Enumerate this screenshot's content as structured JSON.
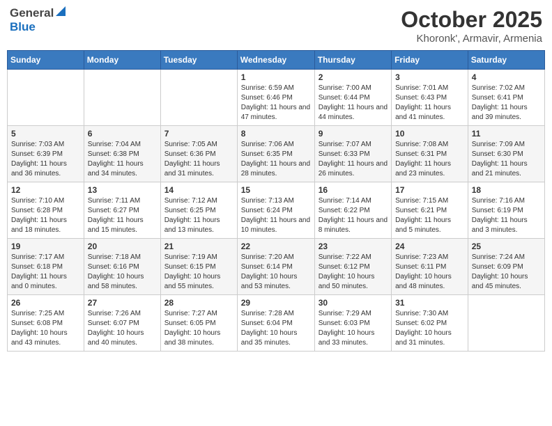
{
  "header": {
    "logo_general": "General",
    "logo_blue": "Blue",
    "month_title": "October 2025",
    "location": "Khoronk', Armavir, Armenia"
  },
  "weekdays": [
    "Sunday",
    "Monday",
    "Tuesday",
    "Wednesday",
    "Thursday",
    "Friday",
    "Saturday"
  ],
  "weeks": [
    [
      {
        "num": "",
        "info": ""
      },
      {
        "num": "",
        "info": ""
      },
      {
        "num": "",
        "info": ""
      },
      {
        "num": "1",
        "info": "Sunrise: 6:59 AM\nSunset: 6:46 PM\nDaylight: 11 hours and 47 minutes."
      },
      {
        "num": "2",
        "info": "Sunrise: 7:00 AM\nSunset: 6:44 PM\nDaylight: 11 hours and 44 minutes."
      },
      {
        "num": "3",
        "info": "Sunrise: 7:01 AM\nSunset: 6:43 PM\nDaylight: 11 hours and 41 minutes."
      },
      {
        "num": "4",
        "info": "Sunrise: 7:02 AM\nSunset: 6:41 PM\nDaylight: 11 hours and 39 minutes."
      }
    ],
    [
      {
        "num": "5",
        "info": "Sunrise: 7:03 AM\nSunset: 6:39 PM\nDaylight: 11 hours and 36 minutes."
      },
      {
        "num": "6",
        "info": "Sunrise: 7:04 AM\nSunset: 6:38 PM\nDaylight: 11 hours and 34 minutes."
      },
      {
        "num": "7",
        "info": "Sunrise: 7:05 AM\nSunset: 6:36 PM\nDaylight: 11 hours and 31 minutes."
      },
      {
        "num": "8",
        "info": "Sunrise: 7:06 AM\nSunset: 6:35 PM\nDaylight: 11 hours and 28 minutes."
      },
      {
        "num": "9",
        "info": "Sunrise: 7:07 AM\nSunset: 6:33 PM\nDaylight: 11 hours and 26 minutes."
      },
      {
        "num": "10",
        "info": "Sunrise: 7:08 AM\nSunset: 6:31 PM\nDaylight: 11 hours and 23 minutes."
      },
      {
        "num": "11",
        "info": "Sunrise: 7:09 AM\nSunset: 6:30 PM\nDaylight: 11 hours and 21 minutes."
      }
    ],
    [
      {
        "num": "12",
        "info": "Sunrise: 7:10 AM\nSunset: 6:28 PM\nDaylight: 11 hours and 18 minutes."
      },
      {
        "num": "13",
        "info": "Sunrise: 7:11 AM\nSunset: 6:27 PM\nDaylight: 11 hours and 15 minutes."
      },
      {
        "num": "14",
        "info": "Sunrise: 7:12 AM\nSunset: 6:25 PM\nDaylight: 11 hours and 13 minutes."
      },
      {
        "num": "15",
        "info": "Sunrise: 7:13 AM\nSunset: 6:24 PM\nDaylight: 11 hours and 10 minutes."
      },
      {
        "num": "16",
        "info": "Sunrise: 7:14 AM\nSunset: 6:22 PM\nDaylight: 11 hours and 8 minutes."
      },
      {
        "num": "17",
        "info": "Sunrise: 7:15 AM\nSunset: 6:21 PM\nDaylight: 11 hours and 5 minutes."
      },
      {
        "num": "18",
        "info": "Sunrise: 7:16 AM\nSunset: 6:19 PM\nDaylight: 11 hours and 3 minutes."
      }
    ],
    [
      {
        "num": "19",
        "info": "Sunrise: 7:17 AM\nSunset: 6:18 PM\nDaylight: 11 hours and 0 minutes."
      },
      {
        "num": "20",
        "info": "Sunrise: 7:18 AM\nSunset: 6:16 PM\nDaylight: 10 hours and 58 minutes."
      },
      {
        "num": "21",
        "info": "Sunrise: 7:19 AM\nSunset: 6:15 PM\nDaylight: 10 hours and 55 minutes."
      },
      {
        "num": "22",
        "info": "Sunrise: 7:20 AM\nSunset: 6:14 PM\nDaylight: 10 hours and 53 minutes."
      },
      {
        "num": "23",
        "info": "Sunrise: 7:22 AM\nSunset: 6:12 PM\nDaylight: 10 hours and 50 minutes."
      },
      {
        "num": "24",
        "info": "Sunrise: 7:23 AM\nSunset: 6:11 PM\nDaylight: 10 hours and 48 minutes."
      },
      {
        "num": "25",
        "info": "Sunrise: 7:24 AM\nSunset: 6:09 PM\nDaylight: 10 hours and 45 minutes."
      }
    ],
    [
      {
        "num": "26",
        "info": "Sunrise: 7:25 AM\nSunset: 6:08 PM\nDaylight: 10 hours and 43 minutes."
      },
      {
        "num": "27",
        "info": "Sunrise: 7:26 AM\nSunset: 6:07 PM\nDaylight: 10 hours and 40 minutes."
      },
      {
        "num": "28",
        "info": "Sunrise: 7:27 AM\nSunset: 6:05 PM\nDaylight: 10 hours and 38 minutes."
      },
      {
        "num": "29",
        "info": "Sunrise: 7:28 AM\nSunset: 6:04 PM\nDaylight: 10 hours and 35 minutes."
      },
      {
        "num": "30",
        "info": "Sunrise: 7:29 AM\nSunset: 6:03 PM\nDaylight: 10 hours and 33 minutes."
      },
      {
        "num": "31",
        "info": "Sunrise: 7:30 AM\nSunset: 6:02 PM\nDaylight: 10 hours and 31 minutes."
      },
      {
        "num": "",
        "info": ""
      }
    ]
  ]
}
